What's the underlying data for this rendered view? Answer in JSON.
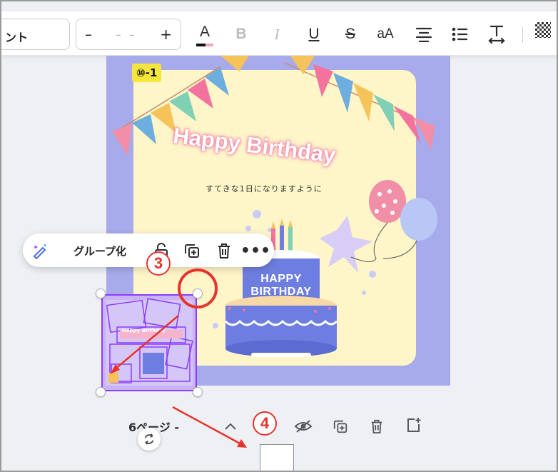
{
  "toolbar": {
    "font_name": "ント",
    "font_size": {
      "minus": "–",
      "value": "– –",
      "plus": "+"
    },
    "buttons": {
      "text_color": "A",
      "bold": "B",
      "italic": "I",
      "underline": "U",
      "strikethrough": "S",
      "case": "aA"
    }
  },
  "canvas": {
    "page_badge": "⑩-1",
    "title": "Happy Birthday",
    "subtitle": "すてきな1日になりますように",
    "cake_line1": "HAPPY",
    "cake_line2": "BIRTHDAY",
    "colors": {
      "page_background": "#a7abeb",
      "card": "#fef5c9",
      "accent_pink": "#f4739e",
      "cake_blue": "#6e7ee0"
    }
  },
  "context_menu": {
    "group_label": "グループ化"
  },
  "selection": {
    "thumbnail_title": "Happy Birthday"
  },
  "annotations": {
    "step3": "3",
    "step4": "4",
    "color": "#e8322c"
  },
  "page_bar": {
    "label": "6ページ -"
  }
}
